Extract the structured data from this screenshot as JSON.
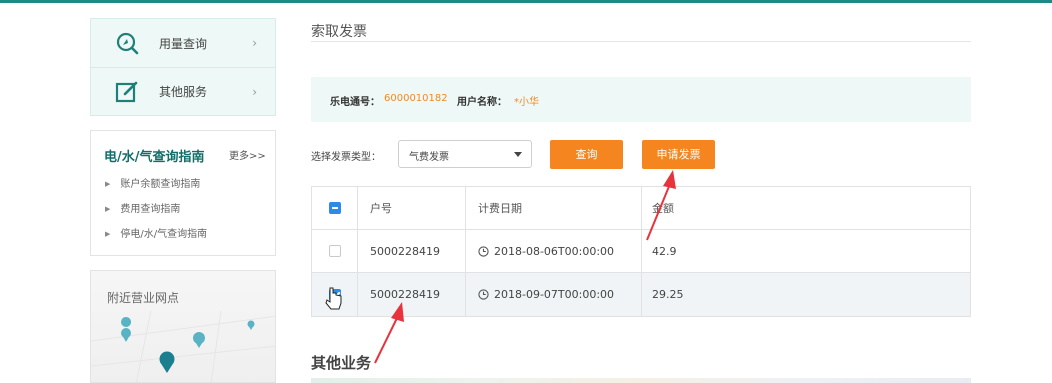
{
  "sidebar": {
    "services": [
      {
        "label": "用量查询",
        "icon": "search-gauge-icon"
      },
      {
        "label": "其他服务",
        "icon": "edit-icon"
      }
    ],
    "guide": {
      "title": "电/水/气查询指南",
      "more": "更多>>",
      "items": [
        "账户余额查询指南",
        "费用查询指南",
        "停电/水/气查询指南"
      ]
    },
    "nearby": {
      "title": "附近营业网点"
    }
  },
  "main": {
    "title": "索取发票",
    "account": {
      "number_label": "乐电通号：",
      "number_value": "6000010182",
      "name_label": "用户名称：",
      "name_value": "*小华"
    },
    "filter": {
      "type_label": "选择发票类型：",
      "type_value": "气费发票",
      "query_button": "查询",
      "apply_button": "申请发票"
    },
    "table": {
      "columns": [
        "户号",
        "计费日期",
        "金额"
      ],
      "rows": [
        {
          "account": "5000228419",
          "date": "2018-08-06T00:00:00",
          "amount": "42.9",
          "checked": false
        },
        {
          "account": "5000228419",
          "date": "2018-09-07T00:00:00",
          "amount": "29.25",
          "checked": true
        }
      ]
    },
    "other_title": "其他业务"
  },
  "colors": {
    "accent": "#f5861f",
    "teal": "#126e6a",
    "checkbox": "#2d8ae6",
    "annotation": "#e8323c"
  }
}
